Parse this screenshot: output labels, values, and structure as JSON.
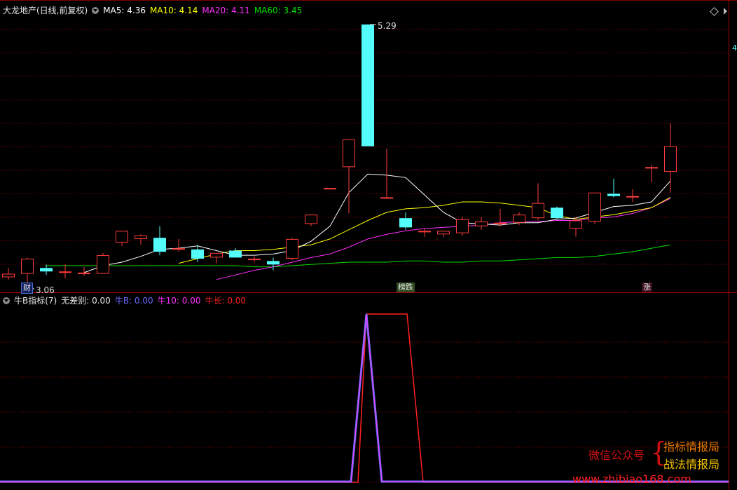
{
  "main_header": {
    "title": "大龙地产(日线,前复权)",
    "ma5_label": "MA5: 4.36",
    "ma10_label": "MA10: 4.14",
    "ma20_label": "MA20: 4.11",
    "ma60_label": "MA60: 3.45"
  },
  "sub_header": {
    "title": "牛B指标(7)",
    "wucha_label": "无差别: 0.00",
    "niub_label": "牛B: 0.00",
    "niu10_label": "牛10: 0.00",
    "niuchang_label": "牛长: 0.00"
  },
  "annotations": {
    "high_label": "5.29",
    "low_label": "3.06",
    "tag_cai": "财",
    "tag_bangdie": "榜跌",
    "tag_zhang": "涨",
    "right_edge_label": "4"
  },
  "watermark": {
    "account_label": "微信公众号",
    "line1": "指标情报局",
    "line2": "战法情报局",
    "url": "www.zhibiao168.com"
  },
  "colors": {
    "up": "#ff3c3c",
    "down": "#54fcfc",
    "ma5": "#ffffff",
    "ma10": "#ffff00",
    "ma20": "#ff30ff",
    "ma60": "#00e000",
    "grid": "#7a0000",
    "niub": "#6a6aff",
    "niuchang": "#ff2020"
  },
  "chart_data": [
    {
      "type": "candlestick",
      "title": "大龙地产(日线,前复权)",
      "ylim": [
        2.98,
        5.35
      ],
      "grid": true,
      "candles": [
        {
          "o": 3.11,
          "h": 3.19,
          "l": 3.09,
          "c": 3.14
        },
        {
          "o": 3.14,
          "h": 3.28,
          "l": 3.06,
          "c": 3.27
        },
        {
          "o": 3.19,
          "h": 3.22,
          "l": 3.13,
          "c": 3.16
        },
        {
          "o": 3.16,
          "h": 3.22,
          "l": 3.1,
          "c": 3.16
        },
        {
          "o": 3.14,
          "h": 3.2,
          "l": 3.12,
          "c": 3.15
        },
        {
          "o": 3.14,
          "h": 3.32,
          "l": 3.14,
          "c": 3.3
        },
        {
          "o": 3.41,
          "h": 3.5,
          "l": 3.38,
          "c": 3.51
        },
        {
          "o": 3.44,
          "h": 3.48,
          "l": 3.39,
          "c": 3.47
        },
        {
          "o": 3.45,
          "h": 3.55,
          "l": 3.3,
          "c": 3.33
        },
        {
          "o": 3.36,
          "h": 3.44,
          "l": 3.33,
          "c": 3.36
        },
        {
          "o": 3.35,
          "h": 3.39,
          "l": 3.24,
          "c": 3.27
        },
        {
          "o": 3.28,
          "h": 3.3,
          "l": 3.23,
          "c": 3.32
        },
        {
          "o": 3.34,
          "h": 3.36,
          "l": 3.28,
          "c": 3.28
        },
        {
          "o": 3.26,
          "h": 3.29,
          "l": 3.24,
          "c": 3.27
        },
        {
          "o": 3.25,
          "h": 3.28,
          "l": 3.17,
          "c": 3.22
        },
        {
          "o": 3.27,
          "h": 3.45,
          "l": 3.26,
          "c": 3.44
        },
        {
          "o": 3.57,
          "h": 3.65,
          "l": 3.55,
          "c": 3.65
        },
        {
          "o": 3.88,
          "h": 3.88,
          "l": 3.88,
          "c": 3.88
        },
        {
          "o": 4.06,
          "h": 4.3,
          "l": 3.66,
          "c": 4.3
        },
        {
          "o": 5.29,
          "h": 5.29,
          "l": 4.24,
          "c": 4.24
        },
        {
          "o": 3.8,
          "h": 4.22,
          "l": 3.8,
          "c": 3.8
        },
        {
          "o": 3.62,
          "h": 3.67,
          "l": 3.52,
          "c": 3.54
        },
        {
          "o": 3.51,
          "h": 3.53,
          "l": 3.46,
          "c": 3.51
        },
        {
          "o": 3.48,
          "h": 3.51,
          "l": 3.46,
          "c": 3.51
        },
        {
          "o": 3.49,
          "h": 3.63,
          "l": 3.47,
          "c": 3.61
        },
        {
          "o": 3.55,
          "h": 3.63,
          "l": 3.52,
          "c": 3.59
        },
        {
          "o": 3.58,
          "h": 3.7,
          "l": 3.55,
          "c": 3.58
        },
        {
          "o": 3.58,
          "h": 3.67,
          "l": 3.56,
          "c": 3.65
        },
        {
          "o": 3.62,
          "h": 3.92,
          "l": 3.6,
          "c": 3.75
        },
        {
          "o": 3.71,
          "h": 3.72,
          "l": 3.61,
          "c": 3.62
        },
        {
          "o": 3.53,
          "h": 3.63,
          "l": 3.46,
          "c": 3.6
        },
        {
          "o": 3.59,
          "h": 3.84,
          "l": 3.57,
          "c": 3.84
        },
        {
          "o": 3.83,
          "h": 3.96,
          "l": 3.8,
          "c": 3.81
        },
        {
          "o": 3.81,
          "h": 3.87,
          "l": 3.76,
          "c": 3.81
        },
        {
          "o": 4.05,
          "h": 4.08,
          "l": 3.93,
          "c": 4.06
        },
        {
          "o": 4.02,
          "h": 4.44,
          "l": 3.84,
          "c": 4.24
        }
      ],
      "ma5": [
        null,
        null,
        null,
        null,
        3.15,
        3.21,
        3.24,
        3.29,
        3.35,
        3.36,
        3.38,
        3.34,
        3.3,
        3.3,
        3.31,
        3.34,
        3.42,
        3.55,
        3.84,
        4.0,
        3.99,
        3.97,
        3.82,
        3.67,
        3.58,
        3.57,
        3.56,
        3.58,
        3.58,
        3.61,
        3.62,
        3.67,
        3.72,
        3.73,
        3.76,
        3.94
      ],
      "ma10": [
        null,
        null,
        null,
        null,
        null,
        null,
        null,
        null,
        null,
        3.23,
        3.27,
        3.31,
        3.34,
        3.34,
        3.35,
        3.37,
        3.39,
        3.44,
        3.52,
        3.6,
        3.67,
        3.7,
        3.71,
        3.73,
        3.76,
        3.76,
        3.75,
        3.73,
        3.71,
        3.64,
        3.61,
        3.63,
        3.65,
        3.68,
        3.71,
        3.8
      ],
      "ma20": [
        null,
        null,
        null,
        null,
        null,
        null,
        null,
        null,
        null,
        null,
        null,
        3.09,
        3.13,
        3.17,
        3.2,
        3.24,
        3.28,
        3.31,
        3.37,
        3.44,
        3.48,
        3.51,
        3.53,
        3.54,
        3.55,
        3.56,
        3.58,
        3.59,
        3.59,
        3.6,
        3.6,
        3.62,
        3.63,
        3.66,
        3.71,
        3.79
      ],
      "ma60": [
        null,
        null,
        3.21,
        3.21,
        3.21,
        3.21,
        3.21,
        3.21,
        3.21,
        3.21,
        3.21,
        3.21,
        3.21,
        3.2,
        3.2,
        3.21,
        3.22,
        3.23,
        3.24,
        3.24,
        3.24,
        3.25,
        3.25,
        3.24,
        3.24,
        3.25,
        3.25,
        3.26,
        3.27,
        3.28,
        3.28,
        3.29,
        3.31,
        3.33,
        3.36,
        3.39
      ],
      "annotations": [
        {
          "text": "5.29",
          "value": 5.29
        },
        {
          "text": "3.06",
          "value": 3.06
        }
      ]
    },
    {
      "type": "line",
      "title": "牛B指标(7)",
      "ylim": [
        0,
        1
      ],
      "series": [
        {
          "name": "牛B",
          "values": [
            0,
            0,
            0,
            0,
            0,
            0,
            0,
            0,
            0,
            0,
            0,
            0,
            0,
            0,
            0,
            0,
            0,
            0,
            0,
            1,
            0,
            0,
            0,
            0,
            0,
            0,
            0,
            0,
            0,
            0,
            0,
            0,
            0,
            0,
            0,
            0
          ]
        },
        {
          "name": "牛长",
          "values": [
            0,
            0,
            0,
            0,
            0,
            0,
            0,
            0,
            0,
            0,
            0,
            0,
            0,
            0,
            0,
            0,
            0,
            0,
            0,
            1,
            1,
            1,
            0,
            0,
            0,
            0,
            0,
            0,
            0,
            0,
            0,
            0,
            0,
            0,
            0,
            0
          ]
        }
      ]
    }
  ]
}
